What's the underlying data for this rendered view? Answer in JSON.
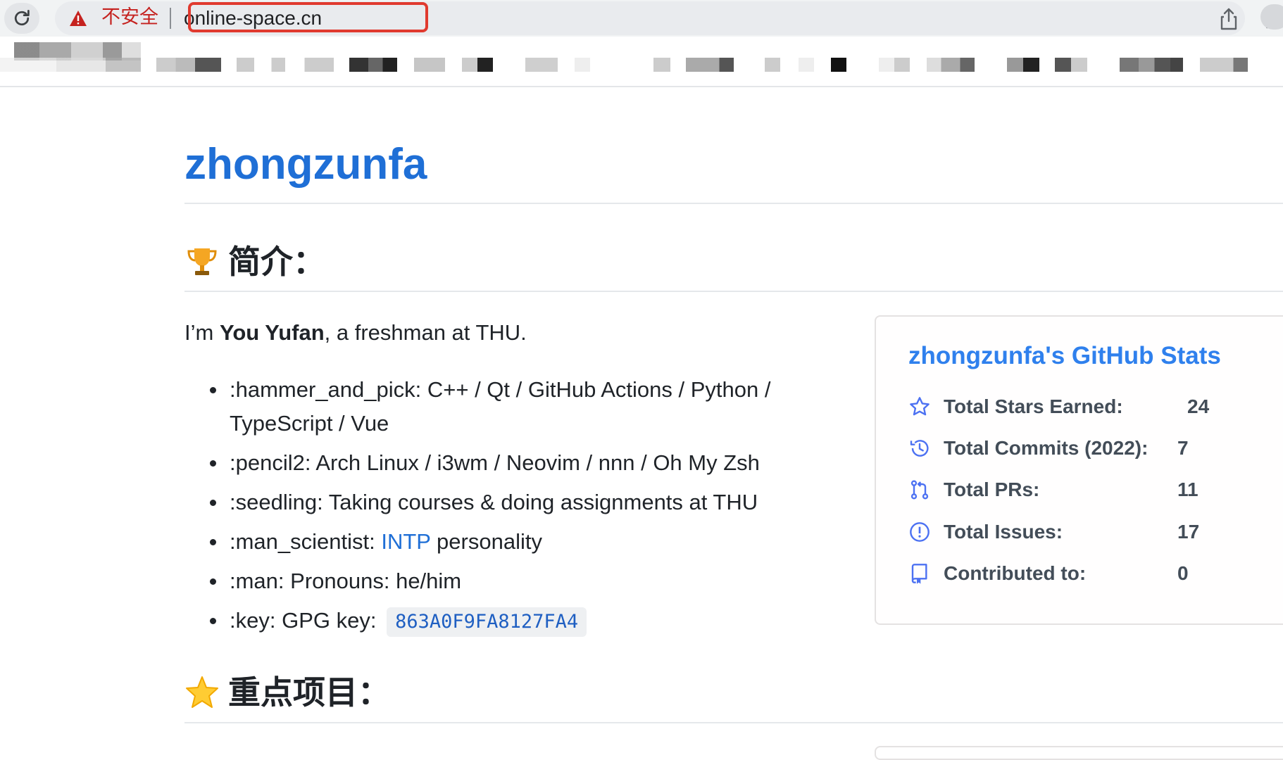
{
  "browser": {
    "security_label": "不安全",
    "url": "online-space.cn"
  },
  "profile": {
    "title": "zhongzunfa"
  },
  "sections": {
    "intro_heading": "简介：",
    "projects_heading": "重点项目："
  },
  "intro": {
    "prefix": "I’m ",
    "name": "You Yufan",
    "suffix": ", a freshman at THU."
  },
  "bullets": {
    "tools": ":hammer_and_pick: C++ / Qt / GitHub Actions / Python / TypeScript / Vue",
    "setup": ":pencil2: Arch Linux / i3wm / Neovim / nnn / Oh My Zsh",
    "learning": ":seedling: Taking courses & doing assignments at THU",
    "personality_prefix": ":man_scientist: ",
    "personality_link": "INTP",
    "personality_suffix": " personality",
    "pronouns": ":man: Pronouns: he/him",
    "gpg_prefix": ":key: GPG key:",
    "gpg_key": "863A0F9FA8127FA4"
  },
  "stats": {
    "title": "zhongzunfa's GitHub Stats",
    "rows": [
      {
        "label": "Total Stars Earned:",
        "value": "24",
        "icon": "star-icon"
      },
      {
        "label": "Total Commits (2022):",
        "value": "7",
        "icon": "history-icon"
      },
      {
        "label": "Total PRs:",
        "value": "11",
        "icon": "pull-request-icon"
      },
      {
        "label": "Total Issues:",
        "value": "17",
        "icon": "issue-icon"
      },
      {
        "label": "Contributed to:",
        "value": "0",
        "icon": "repo-icon"
      }
    ]
  },
  "colors": {
    "link": "#1f6fd6",
    "stats_title": "#2f80ed",
    "warning": "#c5221f",
    "highlight": "#e03a2f"
  }
}
